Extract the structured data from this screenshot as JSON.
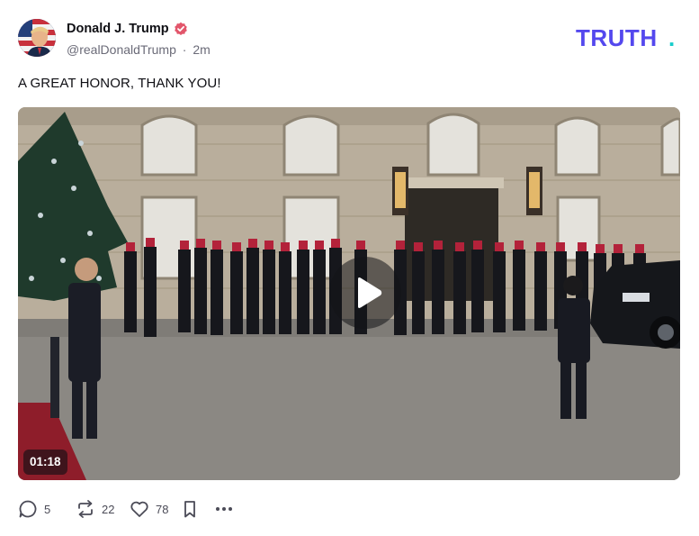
{
  "post": {
    "author": {
      "display_name": "Donald J. Trump",
      "handle": "@realDonaldTrump",
      "separator": "·",
      "timestamp": "2m",
      "verified": true,
      "verified_icon": "verified-badge-icon"
    },
    "brand": {
      "logo_text": "TRUTH",
      "logo_dot": ".",
      "logo_color": "#5448ee",
      "logo_dot_color": "#17cdcb"
    },
    "text": "A GREAT HONOR, THANK YOU!",
    "media": {
      "type": "video",
      "duration": "01:18",
      "play_icon": "play-icon"
    },
    "actions": {
      "replies": {
        "icon": "reply-icon",
        "count": "5"
      },
      "retruths": {
        "icon": "retruth-icon",
        "count": "22"
      },
      "likes": {
        "icon": "heart-icon",
        "count": "78"
      },
      "bookmark": {
        "icon": "bookmark-icon"
      },
      "more": {
        "icon": "more-icon"
      }
    },
    "colors": {
      "verified": "#e2566b",
      "text": "#0f0f14",
      "muted": "#6b6b78"
    }
  }
}
